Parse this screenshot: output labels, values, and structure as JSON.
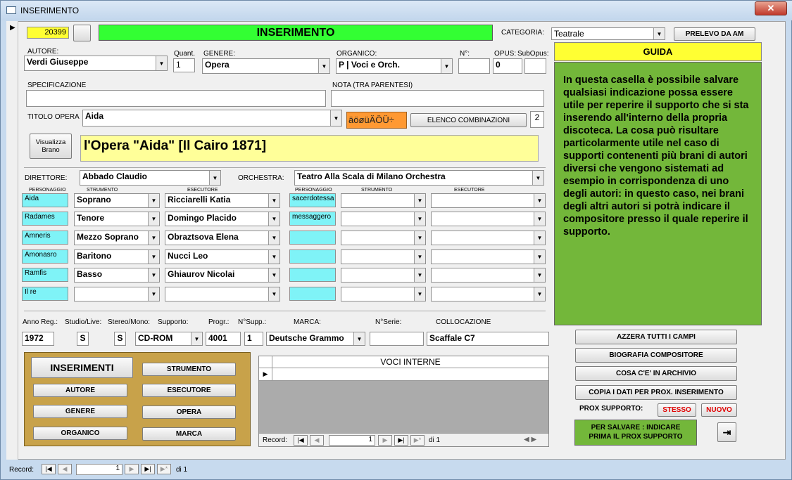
{
  "window": {
    "title": "INSERIMENTO"
  },
  "header": {
    "record_id": "20399",
    "title": "INSERIMENTO",
    "categoria_label": "CATEGORIA:",
    "categoria_value": "Teatrale",
    "prelevo_btn": "PRELEVO DA AM"
  },
  "fields": {
    "autore_label": "AUTORE:",
    "autore": "Verdi Giuseppe",
    "quant_label": "Quant.",
    "quant": "1",
    "genere_label": "GENERE:",
    "genere": "Opera",
    "organico_label": "ORGANICO:",
    "organico": "P | Voci e Orch.",
    "numero_label": "N°:",
    "numero": "",
    "opus_label": "OPUS:",
    "opus": "0",
    "subopus_label": "SubOpus:",
    "subopus": "",
    "specificazione_label": "SPECIFICAZIONE",
    "specificazione": "",
    "nota_label": "NOTA (TRA PARENTESI)",
    "nota": "",
    "titolo_label": "TITOLO OPERA",
    "titolo": "Aida",
    "special_chars": "äöøüÄÖÜ÷",
    "elenco_btn": "ELENCO COMBINAZIONI",
    "elenco_count": "2",
    "visualizza_btn": "Visualizza Brano",
    "brano": "l'Opera \"Aida\" [Il Cairo 1871]",
    "direttore_label": "DIRETTORE:",
    "direttore": "Abbado Claudio",
    "orchestra_label": "ORCHESTRA:",
    "orchestra": "Teatro Alla Scala di Milano Orchestra"
  },
  "cast_headers": {
    "personaggio": "PERSONAGGIO",
    "strumento": "STRUMENTO",
    "esecutore": "ESECUTORE"
  },
  "cast_left": [
    {
      "personaggio": "Aida",
      "strumento": "Soprano",
      "esecutore": "Ricciarelli Katia"
    },
    {
      "personaggio": "Radames",
      "strumento": "Tenore",
      "esecutore": "Domingo Placido"
    },
    {
      "personaggio": "Amneris",
      "strumento": "Mezzo Soprano",
      "esecutore": "Obraztsova Elena"
    },
    {
      "personaggio": "Amonasro",
      "strumento": "Baritono",
      "esecutore": "Nucci Leo"
    },
    {
      "personaggio": "Ramfis",
      "strumento": "Basso",
      "esecutore": "Ghiaurov Nicolai"
    },
    {
      "personaggio": "Il re",
      "strumento": "",
      "esecutore": ""
    }
  ],
  "cast_right": [
    {
      "personaggio": "sacerdotessa",
      "strumento": "",
      "esecutore": ""
    },
    {
      "personaggio": "messaggero",
      "strumento": "",
      "esecutore": ""
    },
    {
      "personaggio": "",
      "strumento": "",
      "esecutore": ""
    },
    {
      "personaggio": "",
      "strumento": "",
      "esecutore": ""
    },
    {
      "personaggio": "",
      "strumento": "",
      "esecutore": ""
    },
    {
      "personaggio": "",
      "strumento": "",
      "esecutore": ""
    }
  ],
  "support": {
    "anno_label": "Anno Reg.:",
    "anno": "1972",
    "studio_label": "Studio/Live:",
    "studio": "S",
    "stereo_label": "Stereo/Mono:",
    "stereo": "S",
    "supporto_label": "Supporto:",
    "supporto": "CD-ROM",
    "progr_label": "Progr.:",
    "progr": "4001",
    "nsupp_label": "N°Supp.:",
    "nsupp": "1",
    "marca_label": "MARCA:",
    "marca": "Deutsche Grammo",
    "nserie_label": "N°Serie:",
    "nserie": "",
    "collocazione_label": "COLLOCAZIONE",
    "collocazione": "Scaffale C7"
  },
  "inserimenti": {
    "title": "INSERIMENTI",
    "strumento": "STRUMENTO",
    "autore": "AUTORE",
    "esecutore": "ESECUTORE",
    "genere": "GENERE",
    "opera": "OPERA",
    "organico": "ORGANICO",
    "marca": "MARCA"
  },
  "voci": {
    "header": "VOCI INTERNE",
    "record_label": "Record:",
    "record_value": "1",
    "of_label": "di 1"
  },
  "guida": {
    "title": "GUIDA",
    "text": "In questa casella è possibile salvare qualsiasi indicazione possa essere utile per reperire il supporto che si sta inserendo all'interno della propria discoteca. La cosa può risultare particolarmente utile nel caso di supporti contenenti più brani di autori diversi che vengono sistemati ad esempio in corrispondenza di uno degli autori: in questo caso, nei brani degli altri autori si potrà indicare il compositore presso il quale reperire il supporto."
  },
  "actions": {
    "azzera": "AZZERA TUTTI I CAMPI",
    "biografia": "BIOGRAFIA  COMPOSITORE",
    "archivio": "COSA C'E' IN ARCHIVIO",
    "copia": "COPIA I DATI PER PROX. INSERIMENTO",
    "prox_label": "PROX SUPPORTO:",
    "stesso": "STESSO",
    "nuovo": "NUOVO",
    "salvare_note": "PER SALVARE :  INDICARE PRIMA IL PROX SUPPORTO"
  },
  "footer": {
    "record_label": "Record:",
    "record_value": "1",
    "of_label": "di 1"
  },
  "colors": {
    "title_green": "#33ff33",
    "guida_green": "#73b73a",
    "guida_yellow": "#ffff33",
    "brown": "#c8a24a",
    "cyan": "#7ff3f7",
    "orange": "#ff9933"
  }
}
